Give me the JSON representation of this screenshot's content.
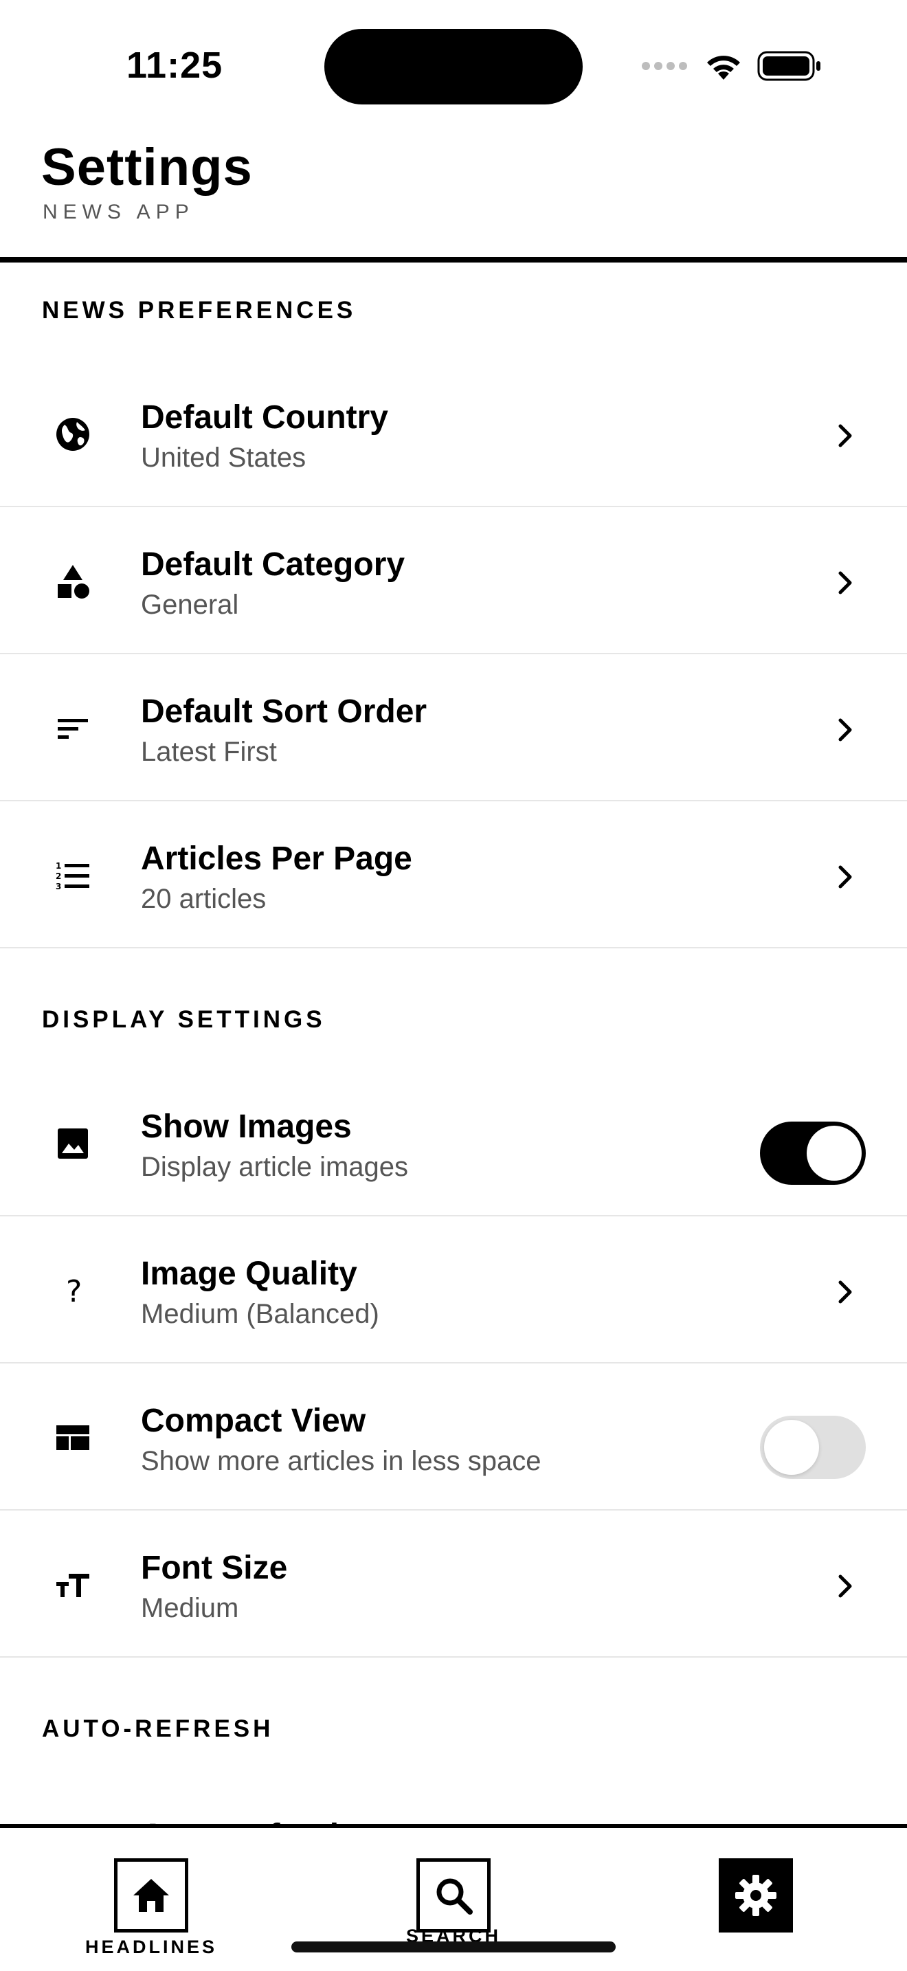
{
  "status_bar": {
    "time": "11:25"
  },
  "header": {
    "title": "Settings",
    "subtitle": "NEWS APP"
  },
  "sections": [
    {
      "title": "NEWS PREFERENCES",
      "items": [
        {
          "title": "Default Country",
          "subtitle": "United States",
          "icon": "globe-icon",
          "control": "chevron"
        },
        {
          "title": "Default Category",
          "subtitle": "General",
          "icon": "category-shapes-icon",
          "control": "chevron"
        },
        {
          "title": "Default Sort Order",
          "subtitle": "Latest First",
          "icon": "sort-icon",
          "control": "chevron"
        },
        {
          "title": "Articles Per Page",
          "subtitle": "20 articles",
          "icon": "numbered-list-icon",
          "control": "chevron"
        }
      ]
    },
    {
      "title": "DISPLAY SETTINGS",
      "items": [
        {
          "title": "Show Images",
          "subtitle": "Display article images",
          "icon": "image-icon",
          "control": "toggle",
          "value": true
        },
        {
          "title": "Image Quality",
          "subtitle": "Medium (Balanced)",
          "icon": "question-icon",
          "control": "chevron"
        },
        {
          "title": "Compact View",
          "subtitle": "Show more articles in less space",
          "icon": "compact-layout-icon",
          "control": "toggle",
          "value": false
        },
        {
          "title": "Font Size",
          "subtitle": "Medium",
          "icon": "font-size-icon",
          "control": "chevron"
        }
      ]
    },
    {
      "title": "AUTO-REFRESH",
      "items": [
        {
          "title": "Auto-Refresh",
          "subtitle": "",
          "icon": "",
          "control": "toggle",
          "value": false
        }
      ]
    }
  ],
  "nav": {
    "items": [
      {
        "label": "HEADLINES",
        "icon": "home-icon",
        "active": false
      },
      {
        "label": "SEARCH",
        "icon": "search-icon",
        "active": false
      },
      {
        "label": "",
        "icon": "gear-icon",
        "active": true
      }
    ]
  },
  "colors": {
    "accent": "#000000",
    "subtitle": "#555555",
    "divider": "#e6e6e6",
    "toggle_off": "#e0e0e0"
  }
}
